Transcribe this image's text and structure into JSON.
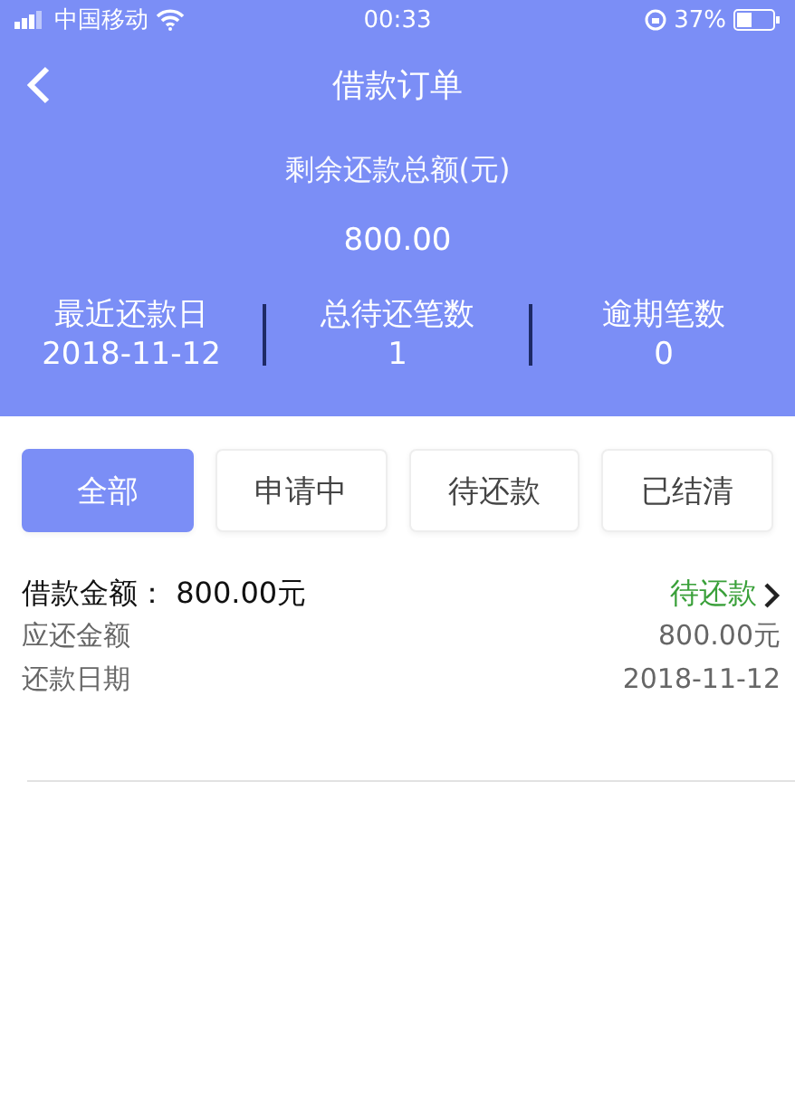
{
  "status_bar": {
    "carrier": "中国移动",
    "time": "00:33",
    "battery": "37%"
  },
  "nav": {
    "title": "借款订单"
  },
  "summary": {
    "label": "剩余还款总额(元)",
    "amount": "800.00"
  },
  "stats": [
    {
      "label": "最近还款日",
      "value": "2018-11-12"
    },
    {
      "label": "总待还笔数",
      "value": "1"
    },
    {
      "label": "逾期笔数",
      "value": "0"
    }
  ],
  "filters": [
    {
      "label": "全部",
      "selected": true
    },
    {
      "label": "申请中",
      "selected": false
    },
    {
      "label": "待还款",
      "selected": false
    },
    {
      "label": "已结清",
      "selected": false
    }
  ],
  "orders": [
    {
      "title": "借款金额： 800.00元",
      "status": "待还款",
      "rows": [
        {
          "label": "应还金额",
          "value": "800.00元"
        },
        {
          "label": "还款日期",
          "value": "2018-11-12"
        }
      ]
    }
  ]
}
